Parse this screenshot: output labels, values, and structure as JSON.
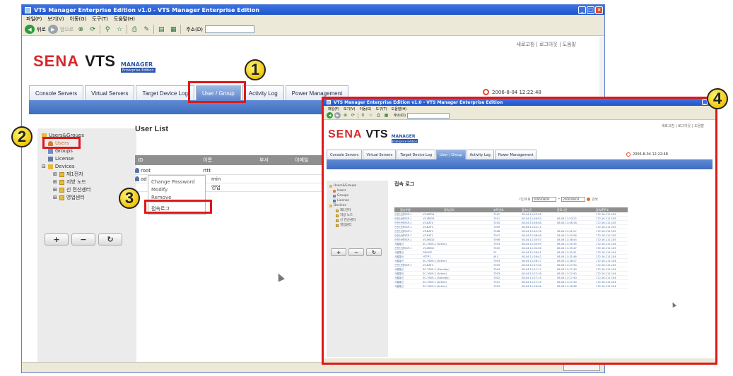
{
  "window": {
    "title": "VTS Manager Enterprise Edition v1.0 - VTS Manager Enterprise Edition",
    "menu": [
      "파일(F)",
      "보기(V)",
      "이동(G)",
      "도구(T)",
      "도움말(H)"
    ],
    "back_label": "뒤로",
    "forward_label": "앞으로",
    "address_label": "주소(D)"
  },
  "header": {
    "top_links": "새로고침 | 로그아웃 | 도움말",
    "logo_sena": "SENA",
    "logo_vts": "VTS",
    "logo_manager": "MANAGER",
    "logo_edition": "Enterprise Edition",
    "datetime": "2006-8-04 12:22:48"
  },
  "tabs": [
    "Console Servers",
    "Virtual Servers",
    "Target Device Log",
    "User / Group",
    "Activity Log",
    "Power Management"
  ],
  "active_tab": "User / Group",
  "sidebar": {
    "root": "Users&Groups",
    "users": "Users",
    "groups": "Groups",
    "license": "License",
    "devices": "Devices",
    "device_groups": [
      "제1전자",
      "지방 노드",
      "신 전산센터",
      "영업센터"
    ],
    "add_label": "+",
    "remove_label": "−",
    "refresh_label": "↻"
  },
  "main": {
    "title": "User List",
    "columns": [
      "ID",
      "이름",
      "부서",
      "이메일"
    ],
    "rows": [
      {
        "id": "root",
        "extra": "rttt"
      },
      {
        "id": "ad",
        "extra": "min"
      },
      {
        "id": "",
        "extra": "영업"
      }
    ]
  },
  "context_menu": {
    "items": [
      "Change Password",
      "Modify",
      "Remove"
    ],
    "login_log": "접속로그"
  },
  "annotations": {
    "badge_1": "1",
    "badge_2": "2",
    "badge_3": "3",
    "badge_4": "4",
    "highlight_color": "#e01818"
  },
  "inset": {
    "title": "VTS Manager Enterprise Edition v1.0 - VTS Manager Enterprise Edition",
    "page_title": "접속 로그",
    "filter_label": "기간조회",
    "date_from": "2006/08/04",
    "date_to": "2006/08/04",
    "search_label": "검색",
    "columns": [
      "접속유형",
      "접속장치",
      "포트번호",
      "접속시간",
      "종료시간",
      "접속IP주소"
    ],
    "rows": [
      [
        "신전산센터SP-1",
        "VS-MED4",
        "7012",
        "08-04 11:53:36",
        "",
        "172.16.111.105"
      ],
      [
        "신전산센터SP-1",
        "VS-MED3",
        "7011",
        "08-04 11:46:02",
        "08-04 11:53:22",
        "172.16.111.105"
      ],
      [
        "신전산센터SP-1",
        "VS-BAT4",
        "7010",
        "08-04 11:46:08",
        "08-04 11:46:18",
        "172.16.111.105"
      ],
      [
        "신전산센터SP-1",
        "VS-BAT3",
        "7009",
        "08-04 11:42:11",
        "",
        "172.16.111.105"
      ],
      [
        "신전산센터SP-1",
        "VS-BAT2",
        "7008",
        "08-04 11:42:16",
        "08-04 11:41:57",
        "172.16.111.105"
      ],
      [
        "신전산센터SP-1",
        "VS-BAT1",
        "7007",
        "08-04 11:38:48",
        "08-04 11:42:06",
        "172.16.111.105"
      ],
      [
        "신전산센터SP-1",
        "VS-MED2",
        "7006",
        "08-04 11:35:53",
        "08-04 11:38:44",
        "172.16.111.105"
      ],
      [
        "서울통신",
        "SC-7609-2 (Active)",
        "7003",
        "08-04 11:35:09",
        "08-04 11:35:35",
        "172.16.111.104"
      ],
      [
        "신전산센터SP-1",
        "VS-MED1",
        "7005",
        "08-04 11:30:56",
        "08-04 11:35:47",
        "172.16.111.105"
      ],
      [
        "서울통신",
        "DEVICE",
        "22",
        "08-04 11:28:01",
        "08-04 11:30:51",
        "172.16.111.104"
      ],
      [
        "서울통신",
        "HTTP1",
        "443",
        "08-04 11:26:42",
        "08-04 11:31:46",
        "172.16.111.104"
      ],
      [
        "서울통신",
        "SC-7609-2 (Active)",
        "7003",
        "08-04 11:26:17",
        "08-04 11:26:27",
        "172.16.111.104"
      ],
      [
        "신전산센터SP-1",
        "VS-BAT3",
        "7009",
        "08-04 11:27:44",
        "08-04 11:27:54",
        "172.16.111.105"
      ],
      [
        "서울통신",
        "SC-7609-2 (Standby)",
        "7004",
        "08-04 11:27:17",
        "08-04 11:27:40",
        "172.16.111.104"
      ],
      [
        "서울통신",
        "SC-7609-2 (Active)",
        "7003",
        "08-04 11:27:16",
        "08-04 11:27:40",
        "172.16.111.104"
      ],
      [
        "서울통신",
        "SC-7609-1 (Standby)",
        "7002",
        "08-04 11:27:15",
        "08-04 11:27:40",
        "172.16.111.104"
      ],
      [
        "서울통신",
        "SC-7609-1 (Active)",
        "7001",
        "08-04 11:27:14",
        "08-04 11:27:40",
        "172.16.111.104"
      ],
      [
        "서울통신",
        "SC-7609-2 (Active)",
        "7003",
        "08-04 11:26:36",
        "08-04 11:26:38",
        "172.16.111.104"
      ]
    ]
  }
}
